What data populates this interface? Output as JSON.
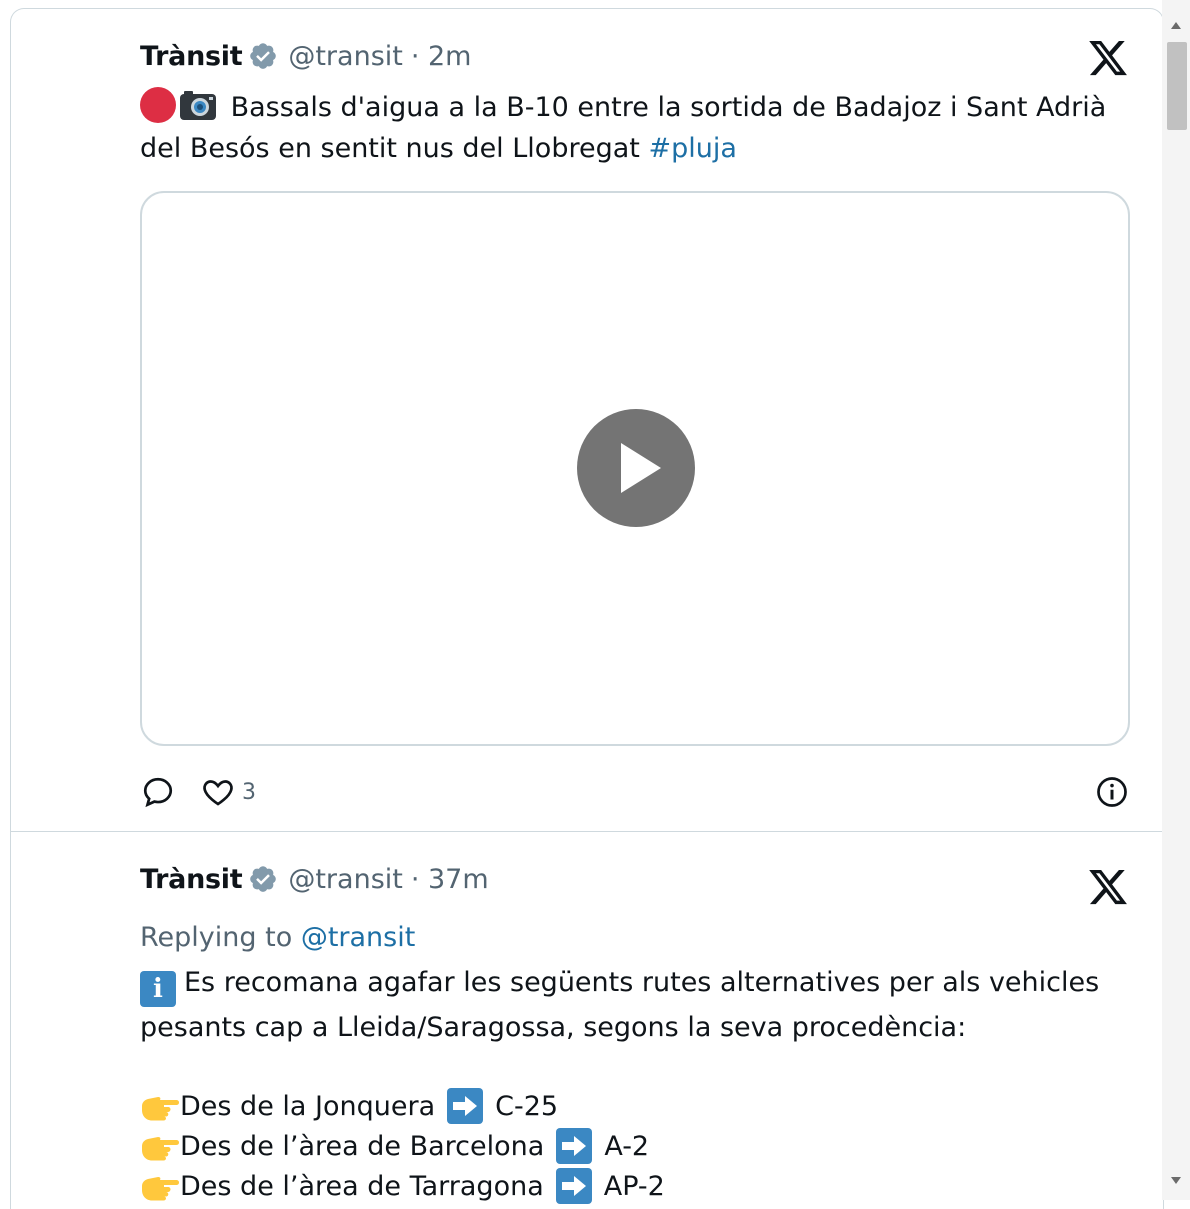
{
  "colors": {
    "link": "#1d6fa5",
    "muted": "#536471",
    "text": "#0f1419",
    "border": "#cfd9de",
    "verified": "#829aab",
    "emoji_blue": "#3b88c3",
    "emoji_red": "#dd2e44"
  },
  "tweet1": {
    "name": "Trànsit",
    "handle": "@transit",
    "time": "· 2m",
    "text": " Bassals d'aigua a la B-10 entre la sortida de Badajoz i Sant Adrià del Besós en sentit nus del Llobregat ",
    "hashtag": "#pluja",
    "likes": "3",
    "icons": [
      "red-circle-emoji",
      "camera-emoji",
      "play-icon",
      "reply-icon",
      "heart-icon",
      "info-icon",
      "x-logo-icon",
      "verified-badge-icon"
    ]
  },
  "tweet2": {
    "name": "Trànsit",
    "handle": "@transit",
    "time": "· 37m",
    "replying_prefix": "Replying to ",
    "replying_to": "@transit",
    "info_glyph": "i",
    "text": "Es recomana agafar les següents rutes alternatives per als vehicles pesants cap a Lleida/Saragossa, segons la seva procedència:",
    "routes": [
      {
        "from": "Des de la Jonquera",
        "road": "C-25"
      },
      {
        "from": "Des de l’àrea de Barcelona",
        "road": "A-2"
      },
      {
        "from": "Des de l’àrea de Tarragona",
        "road": "AP-2"
      }
    ]
  }
}
